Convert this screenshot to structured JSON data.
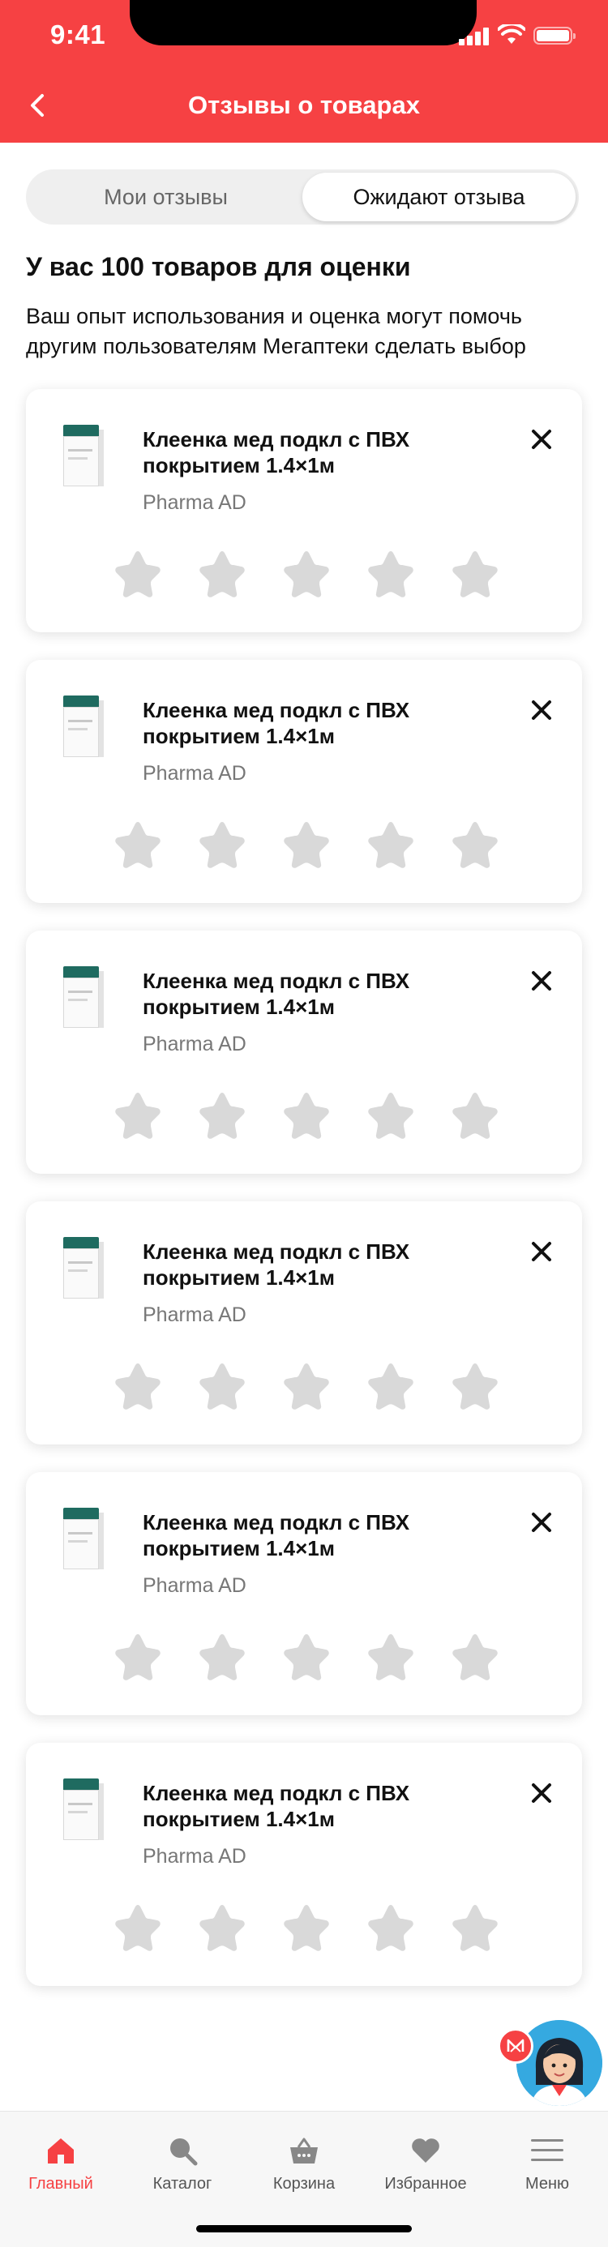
{
  "status_bar": {
    "time": "9:41"
  },
  "header": {
    "title": "Отзывы о товарах"
  },
  "segments": {
    "my_reviews": "Мои отзывы",
    "awaiting": "Ожидают отзыва",
    "active": "awaiting"
  },
  "summary": {
    "title": "У вас 100 товаров для оценки",
    "description": "Ваш опыт использования и оценка могут помочь другим пользователям Мегаптеки сделать выбор"
  },
  "products": [
    {
      "name": "Клеенка мед подкл с ПВХ покрытием 1.4×1м",
      "brand": "Pharma AD",
      "rating": 0
    },
    {
      "name": "Клеенка мед подкл с ПВХ покрытием 1.4×1м",
      "brand": "Pharma AD",
      "rating": 0
    },
    {
      "name": "Клеенка мед подкл с ПВХ покрытием 1.4×1м",
      "brand": "Pharma AD",
      "rating": 0
    },
    {
      "name": "Клеенка мед подкл с ПВХ покрытием 1.4×1м",
      "brand": "Pharma AD",
      "rating": 0
    },
    {
      "name": "Клеенка мед подкл с ПВХ покрытием 1.4×1м",
      "brand": "Pharma AD",
      "rating": 0
    },
    {
      "name": "Клеенка мед подкл с ПВХ покрытием 1.4×1м",
      "brand": "Pharma AD",
      "rating": 0
    }
  ],
  "tabbar": {
    "items": [
      {
        "label": "Главный",
        "icon": "home-icon",
        "active": true
      },
      {
        "label": "Каталог",
        "icon": "search-icon",
        "active": false
      },
      {
        "label": "Корзина",
        "icon": "basket-icon",
        "active": false
      },
      {
        "label": "Избранное",
        "icon": "heart-icon",
        "active": false
      },
      {
        "label": "Меню",
        "icon": "menu-icon",
        "active": false
      }
    ]
  },
  "colors": {
    "accent": "#f64143",
    "star_empty": "#d9d9d9",
    "tab_inactive": "#888888"
  }
}
